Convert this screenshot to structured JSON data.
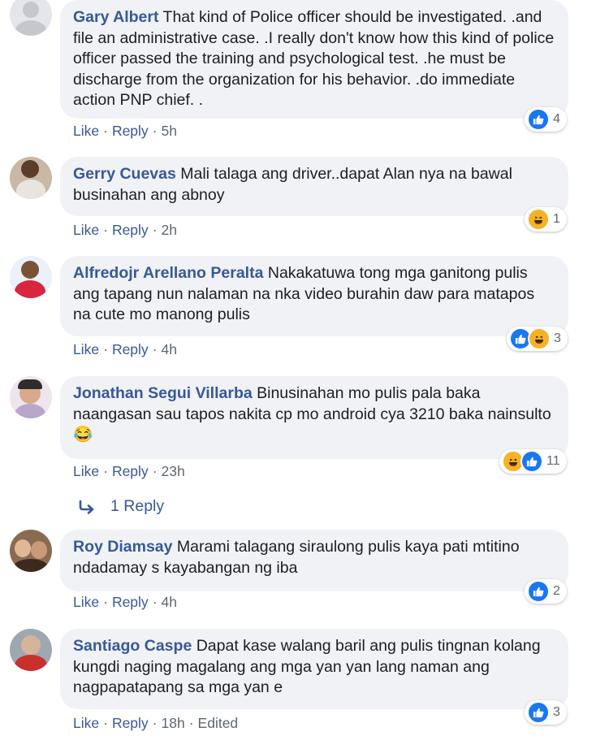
{
  "comments": [
    {
      "author": "Gary Albert",
      "text": " That kind of Police officer should be investigated. .and file an administrative case. .I really don't know how this kind of police officer passed the training and psychological test. .he must be discharge from the organization for his behavior. .do immediate action PNP chief. .",
      "like": "Like",
      "reply": "Reply",
      "time": "5h",
      "reaction_count": "4",
      "reaction_icons": [
        "like-icon"
      ]
    },
    {
      "author": "Gerry Cuevas",
      "text": " Mali talaga ang driver..dapat Alan nya na bawal businahan ang abnoy",
      "like": "Like",
      "reply": "Reply",
      "time": "2h",
      "reaction_count": "1",
      "reaction_icons": [
        "haha-icon"
      ]
    },
    {
      "author": "Alfredojr Arellano Peralta",
      "text": " Nakakatuwa tong mga ganitong pulis ang tapang nun nalaman na nka video burahin daw para matapos na cute mo manong pulis",
      "like": "Like",
      "reply": "Reply",
      "time": "4h",
      "reaction_count": "3",
      "reaction_icons": [
        "like-icon",
        "haha-icon"
      ]
    },
    {
      "author": "Jonathan Segui Villarba",
      "text": " Binusinahan mo pulis pala baka naangasan sau tapos nakita cp mo android cya 3210 baka nainsulto",
      "emoji": "😂",
      "like": "Like",
      "reply": "Reply",
      "time": "23h",
      "reaction_count": "11",
      "reaction_icons": [
        "haha-icon",
        "like-icon"
      ]
    },
    {
      "author": "Roy Diamsay",
      "text": " Marami talagang siraulong pulis kaya pati mtitino ndadamay s kayabangan ng iba",
      "like": "Like",
      "reply": "Reply",
      "time": "4h",
      "reaction_count": "2",
      "reaction_icons": [
        "like-icon"
      ]
    },
    {
      "author": "Santiago Caspe",
      "text": " Dapat kase walang baril ang pulis tingnan kolang kungdi naging magalang ang mga yan yan lang naman ang nagpapatapang sa mga yan e",
      "like": "Like",
      "reply": "Reply",
      "time": "18h",
      "edited": "Edited",
      "reaction_count": "3",
      "reaction_icons": [
        "like-icon"
      ]
    }
  ],
  "replies_link": {
    "label": "1 Reply",
    "icon": "reply-arrow-icon"
  },
  "colors": {
    "link": "#385898",
    "bubble": "#f0f2f5",
    "meta": "#606770",
    "like": "#1877f2",
    "haha": "#f7b125"
  }
}
